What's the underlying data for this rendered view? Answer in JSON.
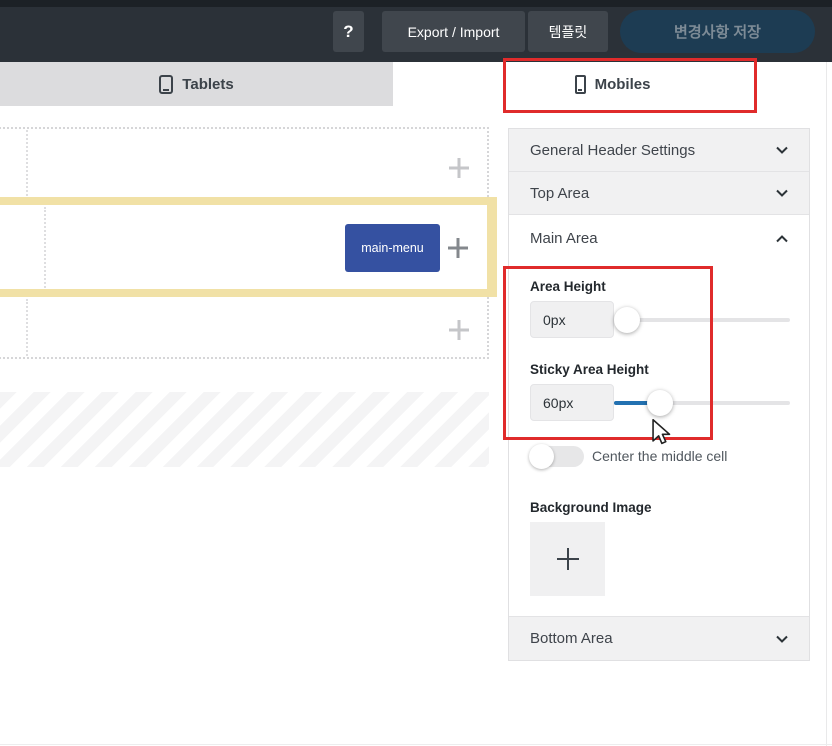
{
  "topbar": {
    "help_label": "?",
    "export_label": "Export / Import",
    "template_label": "템플릿",
    "save_label": "변경사항 저장"
  },
  "tabs": {
    "tablets_label": "Tablets",
    "mobiles_label": "Mobiles",
    "active": "Mobiles"
  },
  "canvas": {
    "main_menu_label": "main-menu",
    "highlighted_row": "Main Area"
  },
  "sidebar": {
    "general": {
      "label": "General Header Settings",
      "state": "collapsed"
    },
    "top": {
      "label": "Top Area",
      "state": "collapsed"
    },
    "main": {
      "label": "Main Area",
      "state": "expanded",
      "area_height": {
        "label": "Area Height",
        "value": "0px"
      },
      "sticky_area_height": {
        "label": "Sticky Area Height",
        "value": "60px"
      },
      "center_toggle": {
        "label": "Center the middle cell",
        "state": "off"
      },
      "background_image": {
        "label": "Background Image"
      }
    },
    "bottom": {
      "label": "Bottom Area",
      "state": "collapsed"
    }
  },
  "colors": {
    "topbar_bg": "#2b3138",
    "save_button_bg": "#1d3c53",
    "annotation_red": "#e02b2b",
    "row_highlight_yellow": "#f1e1a6",
    "main_menu_blue": "#3551a1",
    "slider_fill_blue": "#2271b1",
    "tab_inactive_gray": "#dcdcde"
  }
}
